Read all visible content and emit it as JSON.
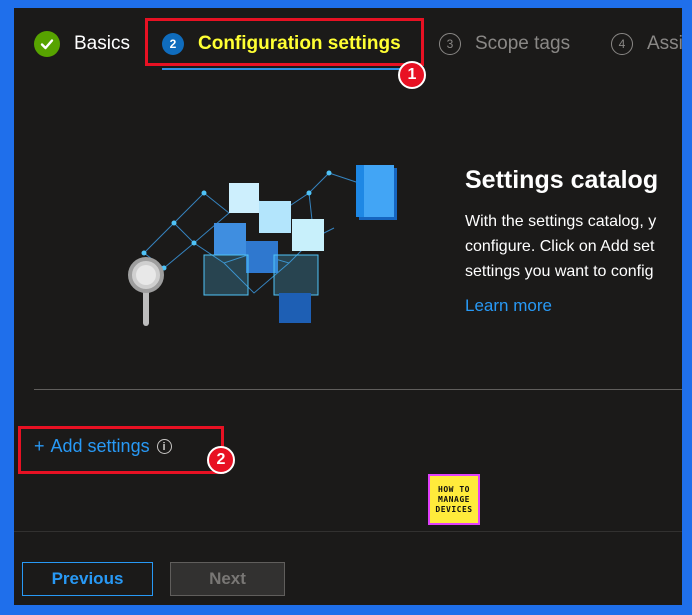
{
  "tabs": [
    {
      "label": "Basics",
      "step": "",
      "state": "done"
    },
    {
      "label": "Configuration settings",
      "step": "2",
      "state": "current"
    },
    {
      "label": "Scope tags",
      "step": "3",
      "state": "future"
    },
    {
      "label": "Assi",
      "step": "4",
      "state": "future"
    }
  ],
  "callouts": {
    "one": "1",
    "two": "2"
  },
  "catalog": {
    "title": "Settings catalog",
    "line1": "With the settings catalog, y",
    "line2": "configure. Click on Add set",
    "line3": "settings you want to config",
    "learn_more": "Learn more"
  },
  "add_settings": {
    "plus": "+",
    "label": "Add settings",
    "info": "i"
  },
  "logo": {
    "line1": "HOW TO",
    "line2": "MANAGE",
    "line3": "DEVICES"
  },
  "buttons": {
    "previous": "Previous",
    "next": "Next"
  },
  "colors": {
    "accent": "#2899f5",
    "active_tab_text": "#ffff33",
    "highlight_red": "#e81123",
    "done_green": "#57a300"
  }
}
